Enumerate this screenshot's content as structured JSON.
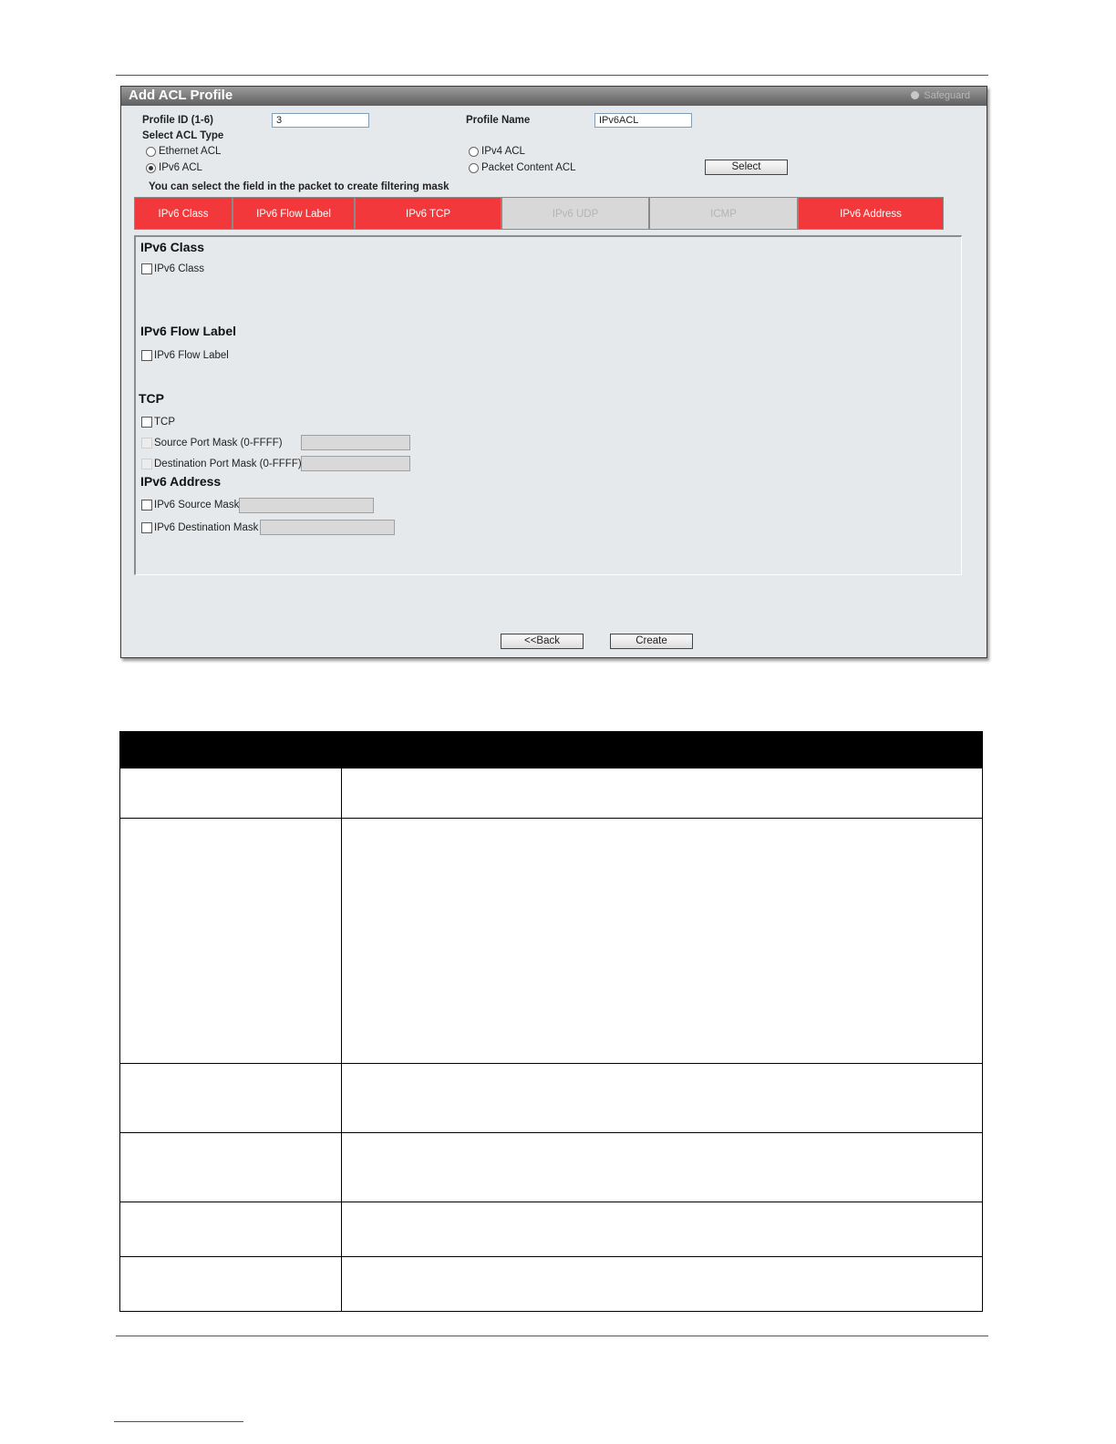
{
  "window": {
    "title": "Add ACL Profile",
    "brand": "Safeguard"
  },
  "form": {
    "profile_id_label": "Profile ID (1-6)",
    "profile_id_value": "3",
    "profile_name_label": "Profile Name",
    "profile_name_value": "IPv6ACL",
    "acl_type_label": "Select ACL Type",
    "options": {
      "ethernet": "Ethernet ACL",
      "ipv4": "IPv4 ACL",
      "ipv6": "IPv6 ACL",
      "packet_content": "Packet Content ACL"
    },
    "selected_option": "ipv6",
    "select_button": "Select",
    "instruction": "You can select the field in the packet to create filtering mask"
  },
  "tabs": [
    {
      "label": "IPv6 Class",
      "active": true
    },
    {
      "label": "IPv6 Flow Label",
      "active": true
    },
    {
      "label": "IPv6 TCP",
      "active": true
    },
    {
      "label": "IPv6 UDP",
      "active": false
    },
    {
      "label": "ICMP",
      "active": false
    },
    {
      "label": "IPv6 Address",
      "active": true
    }
  ],
  "sections": {
    "ipv6_class": {
      "heading": "IPv6 Class",
      "checkbox": "IPv6 Class"
    },
    "flow_label": {
      "heading": "IPv6 Flow Label",
      "checkbox": "IPv6 Flow Label"
    },
    "tcp": {
      "heading": "TCP",
      "checkbox": "TCP",
      "source_port": "Source Port Mask (0-FFFF)",
      "dest_port": "Destination Port Mask (0-FFFF)"
    },
    "address": {
      "heading": "IPv6 Address",
      "source_mask": "IPv6 Source Mask",
      "dest_mask": "IPv6 Destination Mask"
    }
  },
  "buttons": {
    "back": "<<Back",
    "create": "Create"
  },
  "colors": {
    "active_tab": "#f2383a",
    "inactive_tab": "#d8d8d8",
    "window_bg": "#e6e9ec",
    "table_header": "#000000"
  }
}
